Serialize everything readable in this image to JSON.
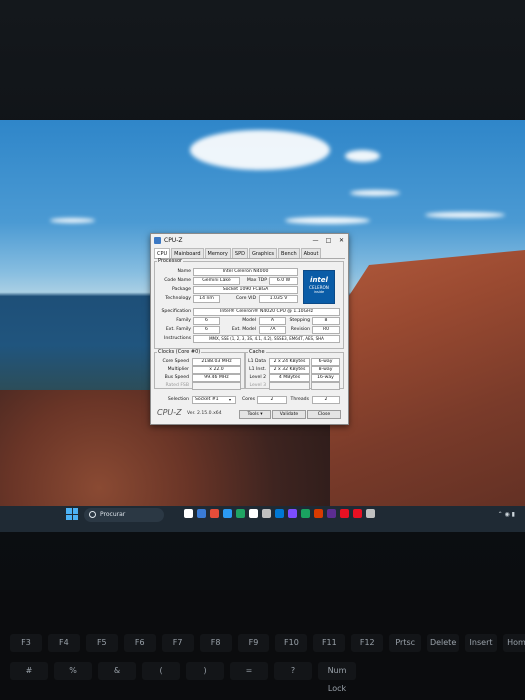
{
  "window": {
    "title": "CPU-Z",
    "minimize": "—",
    "maximize": "□",
    "close": "✕"
  },
  "tabs": [
    "CPU",
    "Mainboard",
    "Memory",
    "SPD",
    "Graphics",
    "Bench",
    "About"
  ],
  "processor": {
    "legend": "Processor",
    "labels": {
      "name": "Name",
      "code_name": "Code Name",
      "max_tdp": "Max TDP",
      "package": "Package",
      "technology": "Technology",
      "core_vid": "Core VID",
      "specification": "Specification",
      "family": "Family",
      "model": "Model",
      "stepping": "Stepping",
      "ext_family": "Ext. Family",
      "ext_model": "Ext. Model",
      "revision": "Revision",
      "instructions": "Instructions"
    },
    "values": {
      "name": "Intel Celeron N4000",
      "code_name": "Gemini Lake",
      "max_tdp": "6.0 W",
      "package": "Socket 1090 FCBGA",
      "technology": "14 nm",
      "core_vid": "1.035 V",
      "specification": "Intel® Celeron® N4020 CPU @ 1.10GHz",
      "family": "6",
      "model": "A",
      "stepping": "8",
      "ext_family": "6",
      "ext_model": "7A",
      "revision": "R0",
      "instructions": "MMX, SSE (1, 2, 3, 3S, 4.1, 4.2), SSSE3, EM64T, AES, SHA"
    },
    "logo": {
      "brand": "intel",
      "line": "CELERON",
      "sub": "inside"
    }
  },
  "clocks": {
    "legend": "Clocks (Core #0)",
    "labels": {
      "core_speed": "Core Speed",
      "multiplier": "Multiplier",
      "bus_speed": "Bus Speed",
      "rated_fsb": "Rated FSB"
    },
    "values": {
      "core_speed": "2188.03 MHz",
      "multiplier": "x 22.0",
      "bus_speed": "99.46 MHz",
      "rated_fsb": ""
    }
  },
  "cache": {
    "legend": "Cache",
    "labels": {
      "l1_data": "L1 Data",
      "l1_inst": "L1 Inst.",
      "level2": "Level 2",
      "level3": "Level 3"
    },
    "values": {
      "l1_data": "2 x 24 KBytes",
      "l1_data_way": "6-way",
      "l1_inst": "2 x 32 KBytes",
      "l1_inst_way": "8-way",
      "level2": "4 MBytes",
      "level2_way": "16-way",
      "level3": "",
      "level3_way": ""
    }
  },
  "selection": {
    "label": "Selection",
    "value": "Socket #1",
    "cores_label": "Cores",
    "cores": "2",
    "threads_label": "Threads",
    "threads": "2"
  },
  "footer": {
    "logo": "CPU-Z",
    "version": "Ver. 2.15.0.x64",
    "tools": "Tools",
    "validate": "Validate",
    "close": "Close"
  },
  "taskbar": {
    "search_placeholder": "Procurar",
    "icon_colors": [
      "#ffffff",
      "#3a7bd5",
      "#e44d3a",
      "#2b9af3",
      "#1fa463",
      "#ffffff",
      "#c0c0c0",
      "#0078d4",
      "#7c4dff",
      "#1aa260",
      "#d83b01",
      "#5c2d91",
      "#e81123",
      "#e81123",
      "#c0c0c0"
    ]
  },
  "keyboard": {
    "row1": [
      "F3",
      "F4",
      "F5",
      "F6",
      "F7",
      "F8",
      "F9",
      "F10",
      "F11",
      "F12",
      "Prtsc",
      "Delete",
      "Insert",
      "Home"
    ],
    "row2": [
      "#",
      "%",
      "&",
      "(",
      ")",
      "=",
      "?",
      "Num Lock"
    ]
  }
}
